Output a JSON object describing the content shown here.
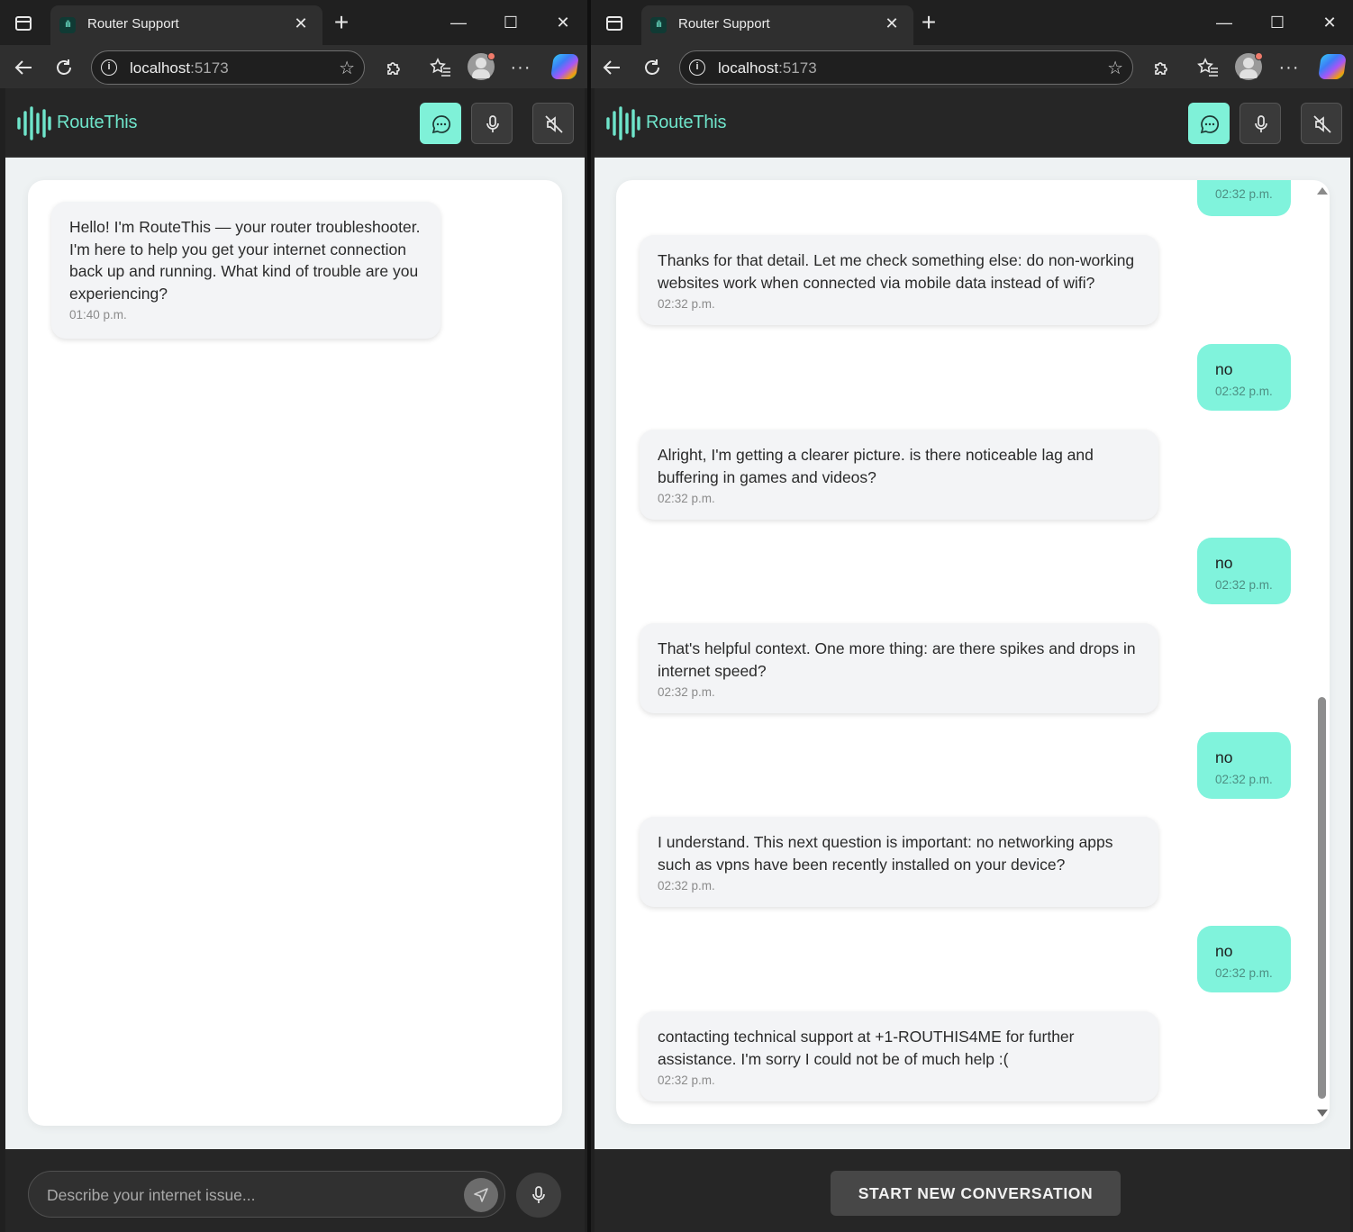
{
  "colors": {
    "accent": "#7ff1d8",
    "brand_text": "#6fe5cb",
    "user_bubble": "#80f3dc",
    "bot_bubble": "#f3f4f6",
    "header_bg": "#262626"
  },
  "icons": {
    "tab_favicon": "waveform-icon",
    "back": "arrow-left-icon",
    "refresh": "refresh-icon",
    "info": "info-icon",
    "star": "star-icon",
    "extensions": "puzzle-icon",
    "favorites": "favorites-icon",
    "more": "more-icon",
    "chat": "chat-bubble-icon",
    "mic": "microphone-icon",
    "mute": "speaker-mute-icon",
    "send": "send-icon"
  },
  "browser": {
    "tab_title": "Router Support",
    "tab_favicon_glyph": "ıllı",
    "close_glyph": "✕",
    "newtab_glyph": "+",
    "minimize_glyph": "—",
    "maximize_glyph": "☐",
    "url_host": "localhost",
    "url_port": ":5173",
    "more_glyph": "···"
  },
  "app": {
    "brand": "RouteThis"
  },
  "left": {
    "messages": [
      {
        "role": "bot",
        "text": "Hello! I'm RouteThis — your router troubleshooter. I'm here to help you get your internet connection back up and running. What kind of trouble are you experiencing?",
        "time": "01:40 p.m."
      }
    ],
    "input_placeholder": "Describe your internet issue..."
  },
  "right": {
    "partial_top_time": "02:32 p.m.",
    "messages": [
      {
        "role": "bot",
        "text": "Thanks for that detail. Let me check something else: do non-working websites work when connected via mobile data instead of wifi?",
        "time": "02:32 p.m."
      },
      {
        "role": "user",
        "text": "no",
        "time": "02:32 p.m."
      },
      {
        "role": "bot",
        "text": "Alright, I'm getting a clearer picture. is there noticeable lag and buffering in games and videos?",
        "time": "02:32 p.m."
      },
      {
        "role": "user",
        "text": "no",
        "time": "02:32 p.m."
      },
      {
        "role": "bot",
        "text": "That's helpful context. One more thing: are there spikes and drops in internet speed?",
        "time": "02:32 p.m."
      },
      {
        "role": "user",
        "text": "no",
        "time": "02:32 p.m."
      },
      {
        "role": "bot",
        "text": "I understand. This next question is important: no networking apps such as vpns have been recently installed on your device?",
        "time": "02:32 p.m."
      },
      {
        "role": "user",
        "text": "no",
        "time": "02:32 p.m."
      },
      {
        "role": "bot",
        "text": "contacting technical support at +1-ROUTHIS4ME for further assistance. I'm sorry I could not be of much help :(",
        "time": "02:32 p.m."
      }
    ],
    "new_conversation_label": "START NEW CONVERSATION"
  }
}
